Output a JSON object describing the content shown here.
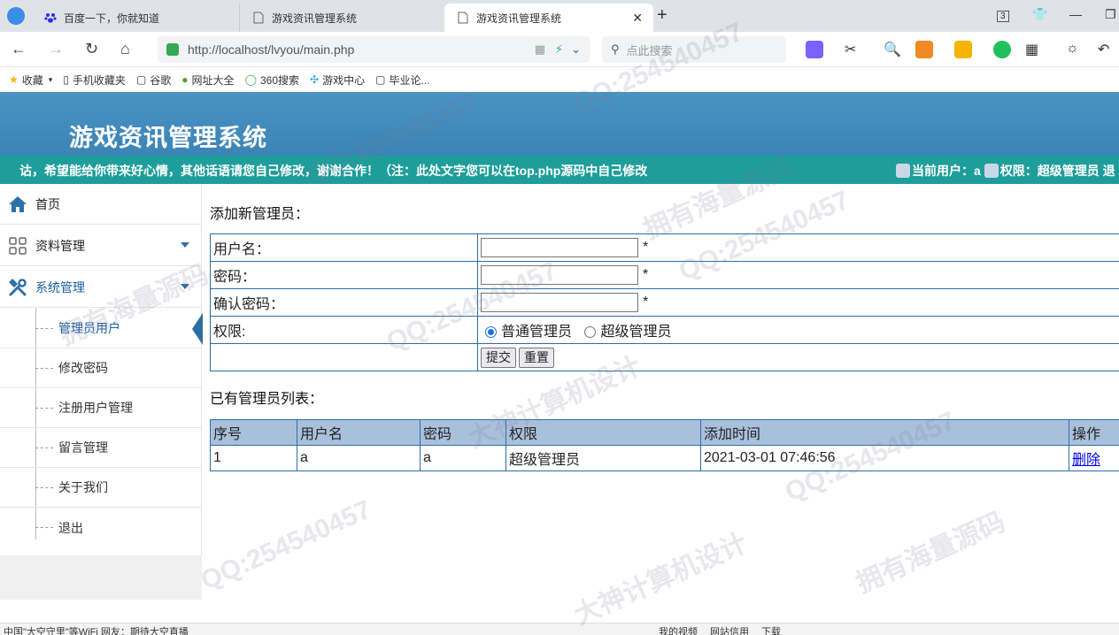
{
  "browser": {
    "tabs": [
      {
        "title": "百度一下，你就知道"
      },
      {
        "title": "游戏资讯管理系统"
      },
      {
        "title": "游戏资讯管理系统"
      }
    ],
    "address": "http://localhost/lvyou/main.php",
    "search_placeholder": "点此搜索",
    "tab_count": "3",
    "bookmarks": [
      "收藏",
      "手机收藏夹",
      "谷歌",
      "网址大全",
      "360搜索",
      "游戏中心",
      "毕业论..."
    ]
  },
  "header": {
    "title": "游戏资讯管理系统",
    "marquee": "诂，希望能给你带来好心情，其他话语请您自己修改，谢谢合作！（注：此处文字您可以在top.php源码中自己修改",
    "user_label": "当前用户：a",
    "role_label": "权限：超级管理员 退"
  },
  "sidebar": {
    "home": "首页",
    "data_mgmt": "资料管理",
    "sys_mgmt": "系统管理",
    "sub_items": [
      "管理员用户",
      "修改密码",
      "注册用户管理",
      "留言管理",
      "关于我们",
      "退出"
    ],
    "active_index": 0
  },
  "form": {
    "title": "添加新管理员：",
    "username_label": "用户名：",
    "password_label": "密码：",
    "confirm_label": "确认密码：",
    "role_label": "权限:",
    "required_mark": "*",
    "role_options": [
      "普通管理员",
      "超级管理员"
    ],
    "role_selected": "普通管理员",
    "submit": "提交",
    "reset": "重置"
  },
  "list": {
    "title": "已有管理员列表：",
    "columns": [
      "序号",
      "用户名",
      "密码",
      "权限",
      "添加时间",
      "操作"
    ],
    "rows": [
      {
        "id": "1",
        "username": "a",
        "password": "a",
        "role": "超级管理员",
        "time": "2021-03-01 07:46:56",
        "action": "删除"
      }
    ]
  },
  "statusbar": {
    "left": "中国\"大空守里\"等WiFi 网友：期待大空直播",
    "right": [
      "我的视频",
      "网站信用",
      "下载"
    ]
  },
  "watermarks": [
    "QQ:254540457",
    "拥有海量源码",
    "大神计算机设计"
  ],
  "colors": {
    "header": "#3b84b6",
    "marquee": "#1e9e9a",
    "border": "#2d6ea3",
    "th_bg": "#a9c0dd"
  }
}
